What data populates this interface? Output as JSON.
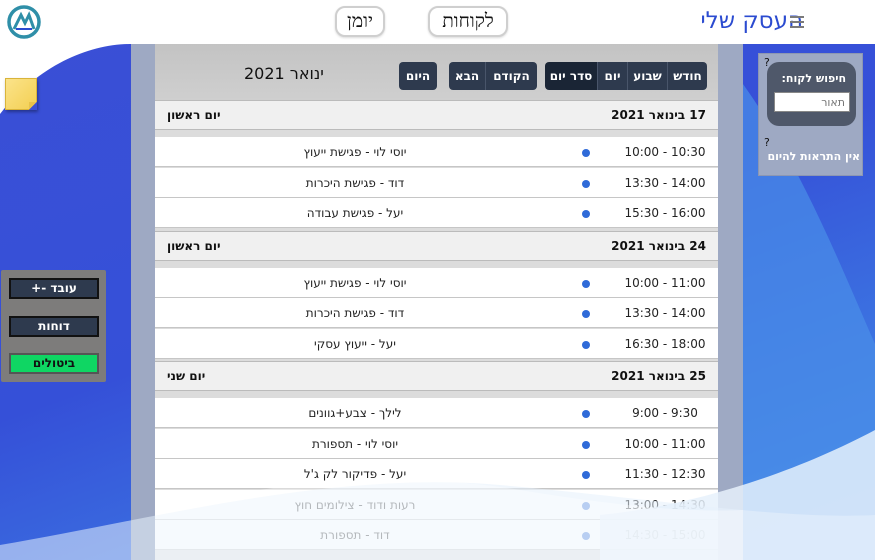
{
  "header": {
    "brand": "העסק שלי",
    "nav": {
      "journal": "יומן",
      "customers": "לקוחות"
    },
    "icons": {
      "logo": "logo-icon",
      "menu": "hamburger-menu-icon"
    }
  },
  "left_tools": {
    "sticky_icon": "sticky-note-icon",
    "worker_button": "עובד -+",
    "reports_button": "דוחות",
    "cancellations_button": "ביטולים"
  },
  "right_panel": {
    "help_mark_1": "?",
    "help_mark_2": "?",
    "customer_search_title": "חיפוש לקוח:",
    "customer_search_placeholder": "תאור",
    "no_alerts": "אין התראות להיום"
  },
  "calendar": {
    "month_label": "ינואר 2021",
    "buttons": {
      "today": "היום",
      "next": "הבא",
      "prev": "הקודם",
      "agenda": "סדר יום",
      "day": "יום",
      "week": "שבוע",
      "month": "חודש"
    },
    "active_view": "סדר יום",
    "days": [
      {
        "date": "17 בינואר 2021",
        "dow": "יום ראשון",
        "events": [
          {
            "time": "10:00 - 10:30",
            "title": "יוסי לוי - פגישת ייעוץ"
          },
          {
            "time": "13:30 - 14:00",
            "title": "דוד - פגישת היכרות"
          },
          {
            "time": "15:30 - 16:00",
            "title": "יעל - פגישת עבודה"
          }
        ]
      },
      {
        "date": "24 בינואר 2021",
        "dow": "יום ראשון",
        "events": [
          {
            "time": "10:00 - 11:00",
            "title": "יוסי לוי - פגישת ייעוץ"
          },
          {
            "time": "13:30 - 14:00",
            "title": "דוד - פגישת היכרות"
          },
          {
            "time": "16:30 - 18:00",
            "title": "יעל - ייעוץ עסקי"
          }
        ]
      },
      {
        "date": "25 בינואר 2021",
        "dow": "יום שני",
        "events": [
          {
            "time": "9:00 - 9:30",
            "title": "לילך - צבע+גוונים"
          },
          {
            "time": "10:00 - 11:00",
            "title": "יוסי לוי - תספורת"
          },
          {
            "time": "11:30 - 12:30",
            "title": "יעל - פדיקור לק ג'ל"
          },
          {
            "time": "13:00 - 14:30",
            "title": "רעות ודוד - צילומים חוץ"
          },
          {
            "time": "14:30 - 15:00",
            "title": "דוד - תספורת"
          }
        ]
      }
    ],
    "event_dot_color": "#2f6ad8"
  },
  "colors": {
    "brand": "#2b4bd0",
    "toolbar_button": "#2e3a4e",
    "cancel_green": "#0fd663"
  }
}
